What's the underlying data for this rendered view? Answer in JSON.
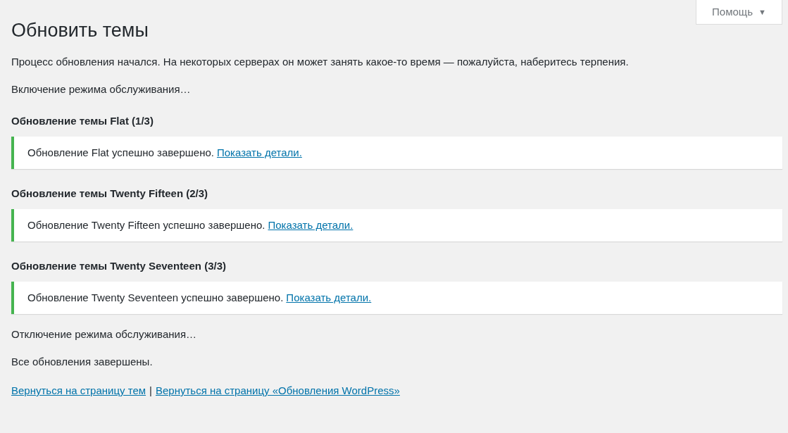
{
  "help_button": {
    "label": "Помощь",
    "arrow": "▼"
  },
  "title": "Обновить темы",
  "log": [
    {
      "kind": "text",
      "text": "Процесс обновления начался. На некоторых серверах он может занять какое-то время — пожалуйста, наберитесь терпения."
    },
    {
      "kind": "text",
      "text": "Включение режима обслуживания…"
    },
    {
      "kind": "heading",
      "text": "Обновление темы Flat (1/3)"
    },
    {
      "kind": "notice",
      "text": "Обновление Flat успешно завершено.",
      "link": "Показать детали.",
      "color": "#46b450"
    },
    {
      "kind": "heading",
      "text": "Обновление темы Twenty Fifteen (2/3)"
    },
    {
      "kind": "notice",
      "text": "Обновление Twenty Fifteen успешно завершено.",
      "link": "Показать детали.",
      "color": "#46b450"
    },
    {
      "kind": "heading",
      "text": "Обновление темы Twenty Seventeen (3/3)"
    },
    {
      "kind": "notice",
      "text": "Обновление Twenty Seventeen успешно завершено.",
      "link": "Показать детали.",
      "color": "#46b450"
    },
    {
      "kind": "text",
      "text": "Отключение режима обслуживания…"
    },
    {
      "kind": "text",
      "text": "Все обновления завершены."
    }
  ],
  "footer_links": [
    {
      "label": "Вернуться на страницу тем"
    },
    {
      "separator": "|",
      "label": "Вернуться на страницу «Обновления WordPress»"
    }
  ]
}
